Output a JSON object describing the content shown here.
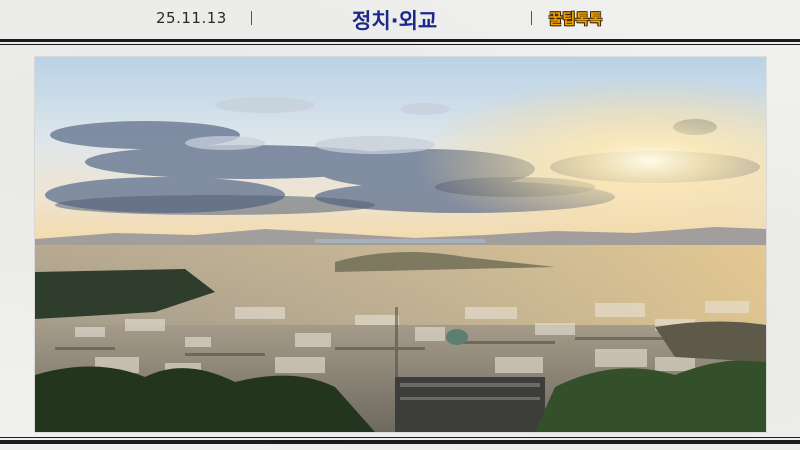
{
  "header": {
    "date": "25.11.13",
    "category": "정치·외교",
    "badge": "꿀팁톡톡"
  },
  "photo": {
    "icon": "city-landscape-image"
  },
  "colors": {
    "category_text": "#1b2a8a",
    "badge_text": "#f5a300",
    "rule": "#1c1c1c"
  }
}
